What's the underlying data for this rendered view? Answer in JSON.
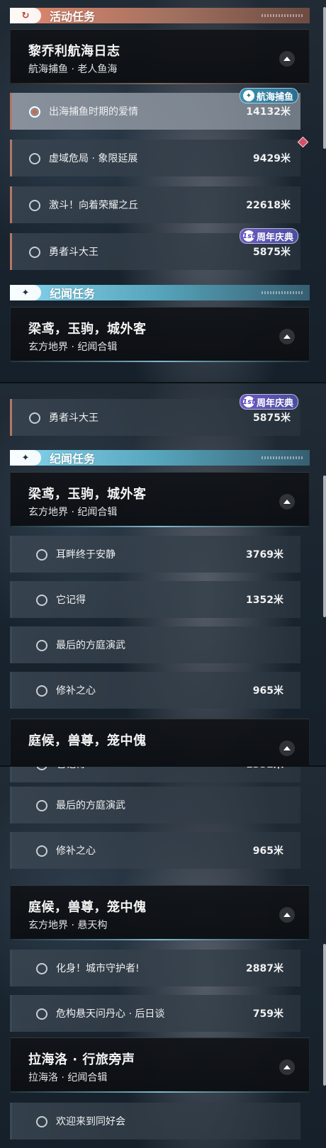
{
  "categories": {
    "activity": {
      "label": "活动任务",
      "icon": "activity-icon"
    },
    "chronicle": {
      "label": "纪闻任务",
      "icon": "sparkle-icon"
    }
  },
  "groups": {
    "liqiao": {
      "title": "黎乔利航海日志",
      "subtitle": "航海捕鱼 · 老人鱼海"
    },
    "liangyuan": {
      "title": "梁鸢，玉驹，城外客",
      "subtitle": "玄方地界 · 纪闻合辑"
    },
    "tinghou": {
      "title": "庭候，兽尊，笼中傀",
      "subtitle": "玄方地界 · 悬天构"
    },
    "lahailuo": {
      "title": "拉海洛 · 行旅旁声",
      "subtitle": "拉海洛 · 纪闻合辑"
    }
  },
  "quests": {
    "q1": {
      "title": "出海捕鱼时期的爱情",
      "distance": "14132米"
    },
    "q2": {
      "title": "虚域危局 · 象限延展",
      "distance": "9429米"
    },
    "q3": {
      "title": "激斗！向着荣耀之丘",
      "distance": "22618米"
    },
    "q4": {
      "title": "勇者斗大王",
      "distance": "5875米"
    },
    "q5": {
      "title": "耳畔终于安静",
      "distance": "3769米"
    },
    "q6": {
      "title": "它记得",
      "distance": "1352米"
    },
    "q7": {
      "title": "最后的方庭演武",
      "distance": ""
    },
    "q8": {
      "title": "修补之心",
      "distance": "965米"
    },
    "q9": {
      "title": "化身！城市守护者!",
      "distance": "2887米"
    },
    "q10": {
      "title": "危构悬天问丹心 · 后日谈",
      "distance": "759米"
    },
    "q11": {
      "title": "欢迎来到同好会",
      "distance": ""
    }
  },
  "badges": {
    "fishing": {
      "label": "航海捕鱼",
      "icon": "fish-icon"
    },
    "anniversary": {
      "label": "周年庆典",
      "icon_text": "1st"
    }
  },
  "colors": {
    "activity_accent": "#d9856c",
    "chronicle_accent": "#7ecde6",
    "alert": "#d4506a"
  }
}
